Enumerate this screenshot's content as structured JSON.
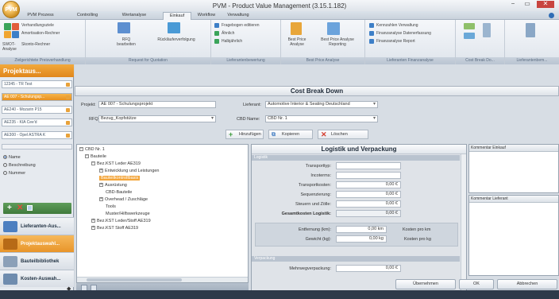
{
  "app": {
    "orb_label": "PVM",
    "title": "PVM - Product Value Management (3.15.1.182)"
  },
  "window_controls": {
    "minimize": "−",
    "maximize": "▭",
    "close": "✕"
  },
  "ribbon_tabs": [
    "PVM Prozess",
    "Controlling",
    "Wertanalyse",
    "Einkauf",
    "Workflow",
    "Verwaltung"
  ],
  "ribbon": {
    "g1": {
      "items": [
        "Verhandlungsziele",
        "Amortisation-Rechner",
        "Skonto-Rechner",
        "SWOT-Analyse"
      ],
      "label": "Zielgerichtete Preisverhandlung"
    },
    "g2": {
      "items": [
        "RFQ bearbeiten",
        "Rückläuferverfolgung"
      ],
      "label": "Request for Quotation"
    },
    "g3": {
      "items": [
        "Fragebogen editieren",
        "Ähnlich",
        "Halbjährlich"
      ],
      "label": "Lieferantenbewertung"
    },
    "g4": {
      "items": [
        "Best Price Analyse",
        "Best Price Analyse Reporting"
      ],
      "label": "Best Price Analyse"
    },
    "g5": {
      "items": [
        "Kennzahlen Verwaltung",
        "Finanzanalyse Datenerfassung",
        "Finanzanalyse Report"
      ],
      "label": "Lieferanten Finanzanalyse"
    },
    "g6": {
      "label": "Cost Break Do..."
    },
    "g7": {
      "label": "Lieferantenbem..."
    }
  },
  "nav": {
    "header": "Projektaus...",
    "projects": [
      "12345 - TR Test",
      "AE 007 - Schulungsp...",
      "AE240 - Mozarin P15",
      "AE235 - KIA Cee'd",
      "AE300 - Opel ASTRA K"
    ],
    "search_options": [
      "Name",
      "Beschreibung",
      "Nummer"
    ],
    "modules": [
      "Lieferanten-Aus...",
      "Projektauswahl...",
      "Bauteilbibliothek",
      "Kosten-Auswah..."
    ]
  },
  "content": {
    "header": "Cost Break Down",
    "project_label": "Projekt:",
    "project_value": "AE 007 - Schulungsprojekt",
    "supplier_label": "Lieferant:",
    "supplier_value": "Automotive Interior & Seating Deutschland",
    "rfq_label": "RFQ:",
    "rfq_value": "Bezug_Kopfstütze",
    "cbd_label": "CBD Name:",
    "cbd_value": "CBD Nr. 1",
    "buttons": {
      "add": "Hinzufügen",
      "copy": "Kopieren",
      "delete": "Löschen"
    }
  },
  "tree": [
    "CBD Nr. 1",
    "Bauteile",
    "Bez.KST Leder AE319",
    "Entwicklung und Leistungen",
    "Bauteilkontrollbasis",
    "Ausrüstung",
    "CBD-Bauteile",
    "Overhead / Zuschläge",
    "Tools",
    "Muster/Hilfswerkzeuge",
    "Bez.KST Leder/Stoff AE319",
    "Bez.KST Stoff AE319"
  ],
  "detail": {
    "title": "Logistik und Verpackung",
    "sec1": "Logistik",
    "sec2": "Verpackung",
    "rows": [
      {
        "label": "Transporttyp:",
        "value": ""
      },
      {
        "label": "Incoterms:",
        "value": ""
      },
      {
        "label": "Transportkosten:",
        "value": "0,00 €"
      },
      {
        "label": "Sequenzierung:",
        "value": "0,00 €"
      },
      {
        "label": "Steuern und Zölle:",
        "value": "0,00 €"
      },
      {
        "label": "Gesamtkosten Logistik:",
        "value": "0,00 €"
      }
    ],
    "dist_label": "Entfernung (km):",
    "dist_value": "0,00 km",
    "dist_unit": "Kosten pro km",
    "weight_label": "Gewicht (kg):",
    "weight_value": "0,00 kg",
    "weight_unit": "Kosten pro kg",
    "pack_label": "Mehrwegverpackung:",
    "pack_value": "0,00 €"
  },
  "comments": {
    "buyer": "Kommentar Einkauf",
    "supplier": "Kommentar Lieferant"
  },
  "footer_buttons": {
    "apply": "Übernehmen",
    "ok": "OK",
    "cancel": "Abbrechen"
  }
}
